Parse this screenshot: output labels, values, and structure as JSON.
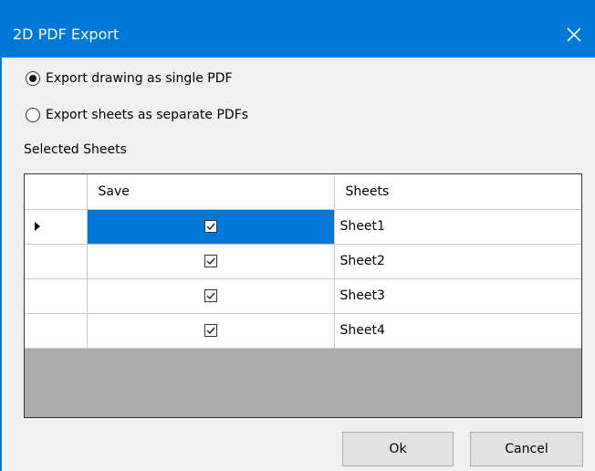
{
  "window": {
    "title": "2D PDF Export",
    "accent": "#0078d7"
  },
  "options": [
    {
      "label": "Export drawing as single PDF",
      "checked": true
    },
    {
      "label": "Export sheets as separate PDFs",
      "checked": false
    }
  ],
  "selected_sheets_label": "Selected Sheets",
  "grid": {
    "columns": [
      "Save",
      "Sheets"
    ],
    "rows": [
      {
        "save": true,
        "sheet": "Sheet1",
        "current": true
      },
      {
        "save": true,
        "sheet": "Sheet2",
        "current": false
      },
      {
        "save": true,
        "sheet": "Sheet3",
        "current": false
      },
      {
        "save": true,
        "sheet": "Sheet4",
        "current": false
      }
    ]
  },
  "buttons": {
    "ok": "Ok",
    "cancel": "Cancel"
  },
  "icons": {
    "close": "close-icon",
    "row_pointer": "row-pointer-icon",
    "check": "checkmark-icon"
  }
}
